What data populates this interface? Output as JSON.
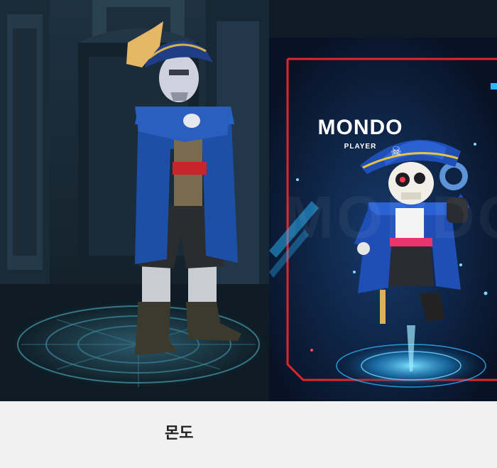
{
  "card": {
    "title": "MONDO",
    "subtitle": "PLAYER",
    "watermark": "MONDO",
    "frame_color": "#e0262a",
    "accent_color": "#2ab7ff"
  },
  "caption": "몬도",
  "icons": {
    "card_emblem": "skull-crossbones-icon"
  }
}
